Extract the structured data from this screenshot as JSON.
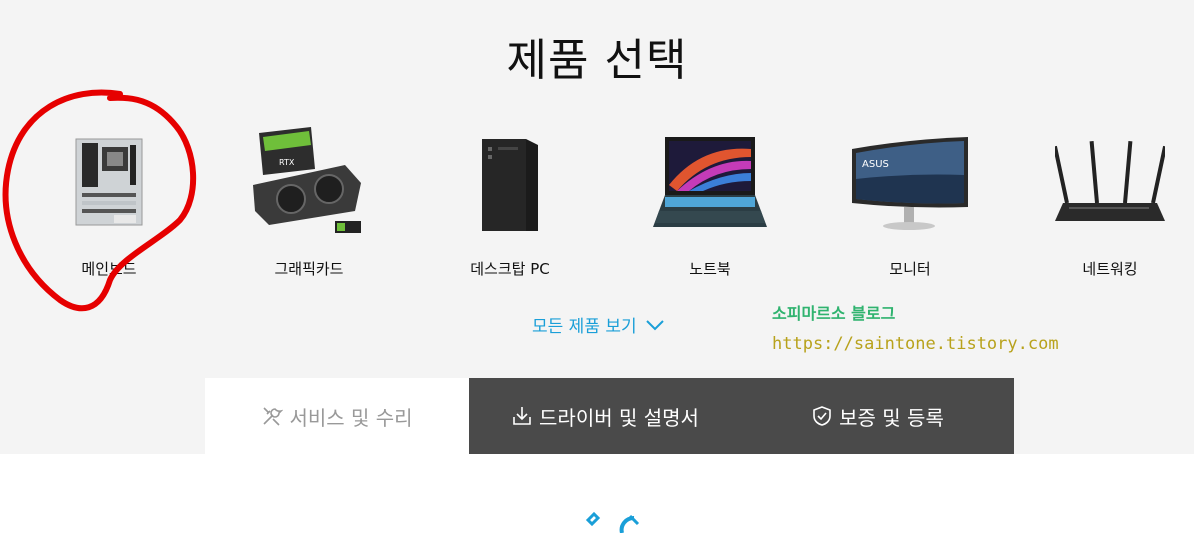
{
  "page_title": "제품 선택",
  "categories": [
    {
      "label": "메인보드",
      "icon": "motherboard-icon"
    },
    {
      "label": "그래픽카드",
      "icon": "graphics-card-icon"
    },
    {
      "label": "데스크탑 PC",
      "icon": "desktop-pc-icon"
    },
    {
      "label": "노트북",
      "icon": "laptop-icon"
    },
    {
      "label": "모니터",
      "icon": "monitor-icon"
    },
    {
      "label": "네트워킹",
      "icon": "router-icon"
    }
  ],
  "all_products": "모든 제품 보기",
  "watermark": {
    "blog_name": "소피마르소 블로그",
    "blog_url": "https://saintone.tistory.com"
  },
  "tabs": [
    {
      "label": "서비스 및 수리",
      "icon": "tools-icon"
    },
    {
      "label": "드라이버 및 설명서",
      "icon": "download-icon"
    },
    {
      "label": "보증 및 등록",
      "icon": "shield-check-icon"
    }
  ],
  "colors": {
    "accent": "#1a9fd8",
    "dark_tab": "#4a4a4a",
    "highlight_circle": "#e60000",
    "watermark_green": "#2fb36f",
    "watermark_olive": "#b8a21c"
  }
}
